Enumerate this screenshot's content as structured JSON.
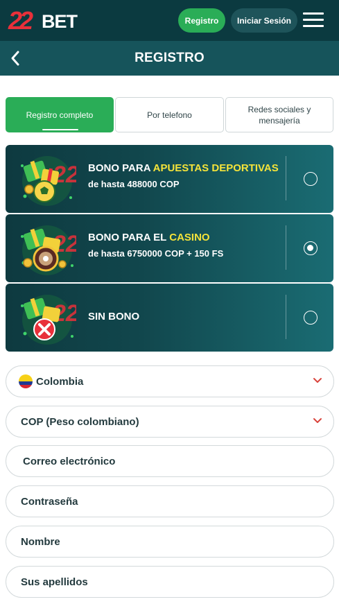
{
  "header": {
    "logo_number": "22",
    "logo_word": "BET",
    "register_label": "Registro",
    "login_label": "Iniciar Sesión"
  },
  "page": {
    "title": "REGISTRO"
  },
  "tabs": [
    {
      "label": "Registro completo",
      "active": true
    },
    {
      "label": "Por telefono",
      "active": false
    },
    {
      "label": "Redes sociales y mensajería",
      "active": false
    }
  ],
  "bonuses": [
    {
      "prefix": "BONO PARA ",
      "highlight": "APUESTAS DEPORTIVAS",
      "detail": "de hasta 488000 COP",
      "selected": false,
      "icon": "gift-football-icon"
    },
    {
      "prefix": "BONO PARA EL ",
      "highlight": "CASINO",
      "detail": "de hasta 6750000 COP + 150 FS",
      "selected": true,
      "icon": "gift-roulette-icon"
    },
    {
      "prefix": "SIN BONO",
      "highlight": "",
      "detail": "",
      "selected": false,
      "icon": "gift-cross-icon"
    }
  ],
  "form": {
    "country": "Colombia",
    "currency": "COP (Peso colombiano)",
    "email_placeholder": "Correo electrónico",
    "password_placeholder": "Contraseña",
    "first_name_placeholder": "Nombre",
    "last_name_placeholder": "Sus apellidos"
  },
  "colors": {
    "header_bg": "#0b3a40",
    "title_bg": "#16545b",
    "accent_green": "#2aad57",
    "highlight_yellow": "#f4e33a",
    "logo_red": "#e8303a",
    "chevron_red": "#d9443c"
  }
}
